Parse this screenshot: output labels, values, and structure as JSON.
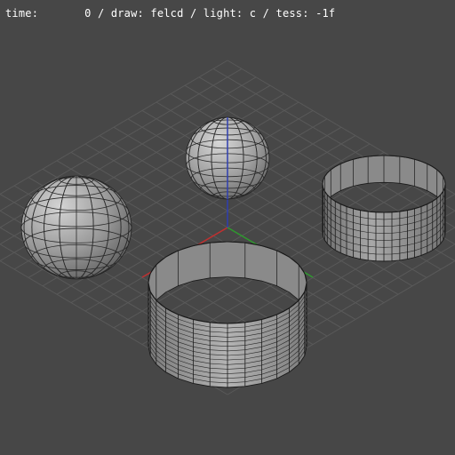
{
  "status": {
    "time_label": "time:",
    "time_value": "0",
    "draw_label": "draw:",
    "draw_value": "felcd",
    "light_label": "light:",
    "light_value": "c",
    "tess_label": "tess:",
    "tess_value": "-1f"
  },
  "colors": {
    "background": "#474747",
    "grid": "#595959",
    "axis_x": "#c03030",
    "axis_y": "#2f3fb0",
    "axis_z": "#2e9a2e",
    "surface": "#8f8f8f",
    "wire": "#1a1a1a"
  },
  "objects": [
    {
      "kind": "sphere",
      "name": "sphere-left"
    },
    {
      "kind": "sphere",
      "name": "sphere-center"
    },
    {
      "kind": "cylinder",
      "name": "cylinder-right"
    },
    {
      "kind": "cylinder",
      "name": "cylinder-front"
    }
  ]
}
